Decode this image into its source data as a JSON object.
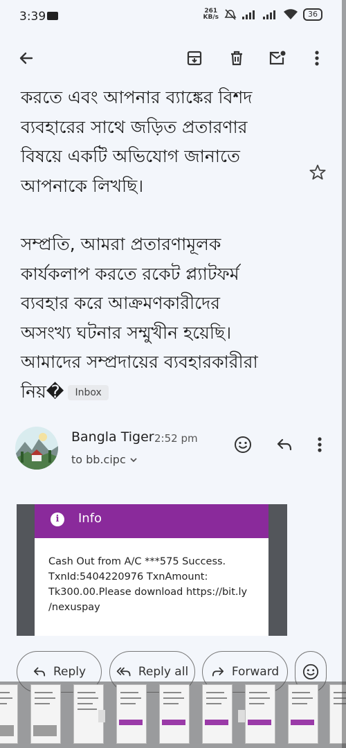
{
  "status": {
    "time": "3:39",
    "speed_value": "261",
    "speed_unit": "KB/s",
    "battery": "36"
  },
  "email": {
    "body_lines_1": [
      "করতে এবং আপনার ব্যাঙ্কের বিশদ",
      "ব্যবহারের সাথে জড়িত প্রতারণার",
      "বিষয়ে একটি অভিযোগ জানাতে",
      "আপনাকে লিখছি।"
    ],
    "body_lines_2": [
      "সম্প্রতি, আমরা প্রতারণামূলক",
      "কার্যকলাপ করতে রকেট প্ল্যাটফর্ম",
      "ব্যবহার করে আক্রমণকারীদের",
      "অসংখ্য ঘটনার সম্মুখীন হয়েছি।",
      "আমাদের সম্প্রদায়ের ব্যবহারকারীরা"
    ],
    "last_line": "নিয়�",
    "label": "Inbox"
  },
  "sender": {
    "name": "Bangla Tiger",
    "time": "2:52 pm",
    "to": "to bb.cipc"
  },
  "attachment": {
    "header": "Info",
    "message_lines": [
      "Cash Out from A/C ***575 Success.",
      "TxnId:5404220976 TxnAmount:",
      "Tk300.00.Please download https://bit.ly",
      "/nexuspay"
    ]
  },
  "actions": {
    "reply": "Reply",
    "reply_all": "Reply all",
    "forward": "Forward"
  },
  "colors": {
    "accent_purple": "#8a2a9b",
    "background": "#f3f6fb"
  },
  "icons": [
    "back-arrow-icon",
    "archive-icon",
    "delete-icon",
    "mark-unread-icon",
    "more-vert-icon",
    "star-icon",
    "emoji-icon",
    "reply-icon",
    "reply-all-icon",
    "forward-icon",
    "info-icon"
  ]
}
